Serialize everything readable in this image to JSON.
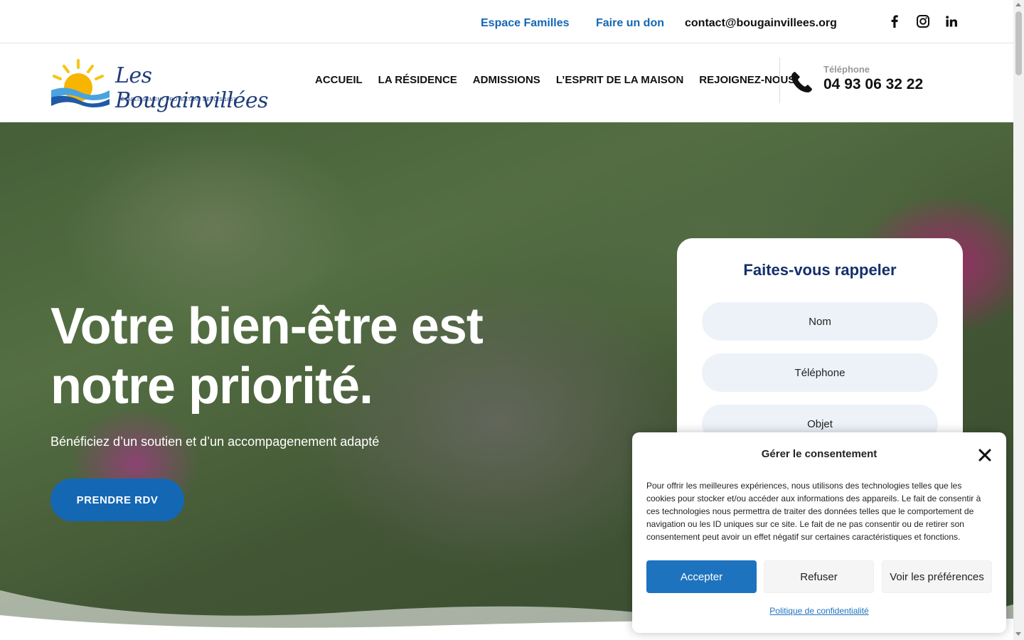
{
  "topbar": {
    "espace_familles": "Espace Familles",
    "faire_un_don": "Faire un don",
    "email": "contact@bougainvillees.org",
    "social": [
      "facebook-icon",
      "instagram-icon",
      "linkedin-icon"
    ]
  },
  "header": {
    "logo_title": "Les Bougainvillées",
    "logo_subtitle": "ÉTABLISSEMENT PROTESTANT DEPUIS 1867",
    "nav": [
      "ACCUEIL",
      "LA RÉSIDENCE",
      "ADMISSIONS",
      "L’ESPRIT DE LA MAISON",
      "REJOIGNEZ-NOUS"
    ],
    "phone_label": "Téléphone",
    "phone_number": "04 93 06 32 22"
  },
  "hero": {
    "title": "Votre bien-être est notre priorité.",
    "subtitle": "Bénéficiez d’un soutien et d’un accompagenement adapté",
    "cta": "PRENDRE RDV"
  },
  "callback_form": {
    "title": "Faites-vous rappeler",
    "fields": [
      "Nom",
      "Téléphone",
      "Objet"
    ]
  },
  "consent": {
    "title": "Gérer le consentement",
    "text": "Pour offrir les meilleures expériences, nous utilisons des technologies telles que les cookies pour stocker et/ou accéder aux informations des appareils. Le fait de consentir à ces technologies nous permettra de traiter des données telles que le comportement de navigation ou les ID uniques sur ce site. Le fait de ne pas consentir ou de retirer son consentement peut avoir un effet négatif sur certaines caractéristiques et fonctions.",
    "accept": "Accepter",
    "refuse": "Refuser",
    "preferences": "Voir les préférences",
    "privacy_link": "Politique de confidentialité"
  },
  "colors": {
    "brand_blue": "#1467b3",
    "navy": "#14306b",
    "consent_blue": "#1e73be"
  }
}
